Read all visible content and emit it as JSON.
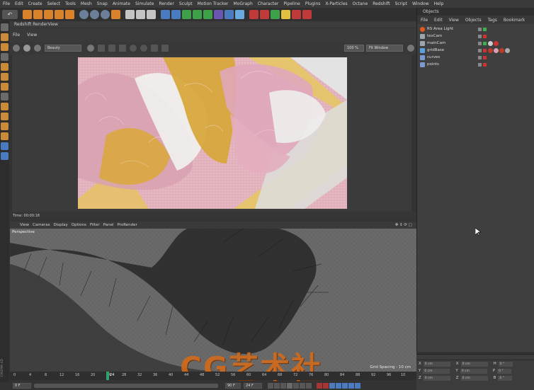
{
  "menubar": [
    "File",
    "Edit",
    "Create",
    "Select",
    "Tools",
    "Mesh",
    "Snap",
    "Animate",
    "Simulate",
    "Render",
    "Sculpt",
    "Motion Tracker",
    "MoGraph",
    "Character",
    "Pipeline",
    "Plugins",
    "X-Particles",
    "Octane",
    "Redshift",
    "Script",
    "Window",
    "Help"
  ],
  "renderview": {
    "title": "Redshift RenderView",
    "menu": [
      "File",
      "View"
    ],
    "aov": "Beauty",
    "zoom": "100 %",
    "fit": "Fit Window",
    "time": "Time: 00:00:18"
  },
  "viewport": {
    "menu": [
      "View",
      "Cameras",
      "Display",
      "Options",
      "Filter",
      "Panel",
      "ProRender"
    ],
    "label": "Perspective",
    "grid_spacing": "Grid Spacing : 10 cm"
  },
  "timeline": {
    "ticks": [
      "0",
      "4",
      "8",
      "12",
      "16",
      "20",
      "24",
      "28",
      "32",
      "36",
      "40",
      "44",
      "48",
      "52",
      "56",
      "60",
      "64",
      "68",
      "72",
      "76",
      "80",
      "84",
      "88",
      "92",
      "96",
      "10"
    ],
    "current_frame": "24",
    "start": "0 F",
    "end": "90 F",
    "fps_field": "24 F",
    "start_field": "0 F"
  },
  "objects": {
    "title": "Objects",
    "menu": [
      "File",
      "Edit",
      "View",
      "Objects",
      "Tags",
      "Bookmark"
    ],
    "items": [
      {
        "name": "RS Area Light",
        "icon_color": "#e05a20"
      },
      {
        "name": "texCam",
        "icon_color": "#9aa5b0"
      },
      {
        "name": "mainCam",
        "icon_color": "#9aa5b0"
      },
      {
        "name": "gridBase",
        "icon_color": "#5aa0e0"
      },
      {
        "name": "curves",
        "icon_color": "#7a9ad0"
      },
      {
        "name": "points",
        "icon_color": "#7a9ad0"
      }
    ]
  },
  "attributes": {
    "rows": [
      {
        "axis": "X",
        "v1": "0 cm",
        "a2": "X",
        "v2": "0 cm",
        "a3": "H",
        "v3": "0 °"
      },
      {
        "axis": "Y",
        "v1": "0 cm",
        "a2": "Y",
        "v2": "0 cm",
        "a3": "P",
        "v3": "0 °"
      },
      {
        "axis": "Z",
        "v1": "0 cm",
        "a2": "Z",
        "v2": "0 cm",
        "a3": "B",
        "v3": "0 °"
      }
    ]
  },
  "watermark": "CG艺术社",
  "vertical_brand": "CINEMA 4D"
}
